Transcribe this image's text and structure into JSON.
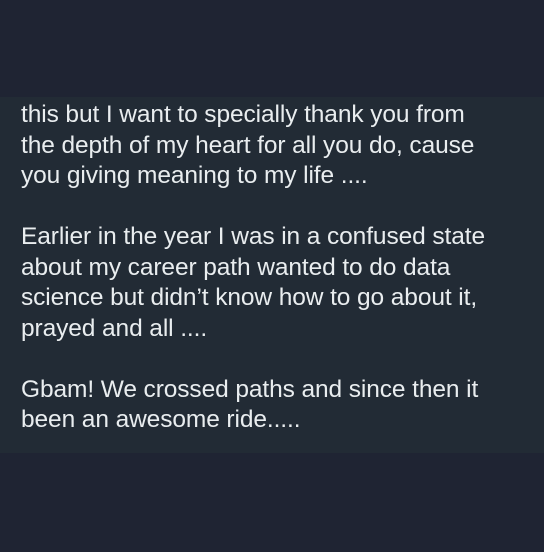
{
  "message": {
    "paragraphs": [
      {
        "lines": [
          "this but I want to specially thank you from",
          "the depth of my heart for all you do, cause",
          "you giving meaning to my life ...."
        ]
      },
      {
        "lines": [
          "Earlier in the year I was in a confused state",
          "about my career path wanted to do data",
          "science but didn’t know how to go about it,",
          "prayed and all ...."
        ]
      },
      {
        "lines": [
          "Gbam! We crossed paths and since then it",
          "been an awesome ride....."
        ]
      }
    ]
  },
  "colors": {
    "background": "#1f2433",
    "bubble": "#222b35",
    "text": "#e9edef"
  }
}
